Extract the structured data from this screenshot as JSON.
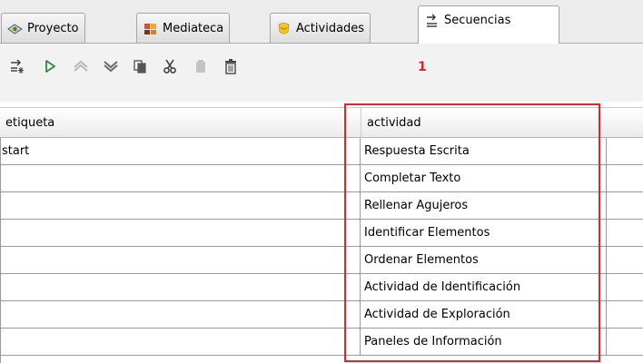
{
  "tabs": [
    {
      "label": "Proyecto",
      "icon": "eye-icon"
    },
    {
      "label": "Mediateca",
      "icon": "media-library-icon"
    },
    {
      "label": "Actividades",
      "icon": "activities-icon"
    },
    {
      "label": "Secuencias",
      "icon": "sequence-icon",
      "active": true
    }
  ],
  "toolbar": {
    "buttons": [
      "add-sequence-icon",
      "play-icon",
      "move-up-icon",
      "move-down-icon",
      "copy-icon",
      "cut-icon",
      "paste-icon",
      "delete-icon"
    ],
    "marker": "1"
  },
  "table": {
    "columns": [
      "etiqueta",
      "actividad"
    ],
    "rows": [
      {
        "etiqueta": "start",
        "actividad": "Respuesta Escrita"
      },
      {
        "etiqueta": "",
        "actividad": "Completar Texto"
      },
      {
        "etiqueta": "",
        "actividad": "Rellenar Agujeros"
      },
      {
        "etiqueta": "",
        "actividad": "Identificar Elementos"
      },
      {
        "etiqueta": "",
        "actividad": "Ordenar Elementos"
      },
      {
        "etiqueta": "",
        "actividad": "Actividad de Identificación"
      },
      {
        "etiqueta": "",
        "actividad": "Actividad de Exploración"
      },
      {
        "etiqueta": "",
        "actividad": "Paneles de Información"
      }
    ]
  },
  "colors": {
    "highlight": "#e0262a",
    "accent_green": "#2f8a3a",
    "icon_gray": "#6b6b6b"
  }
}
